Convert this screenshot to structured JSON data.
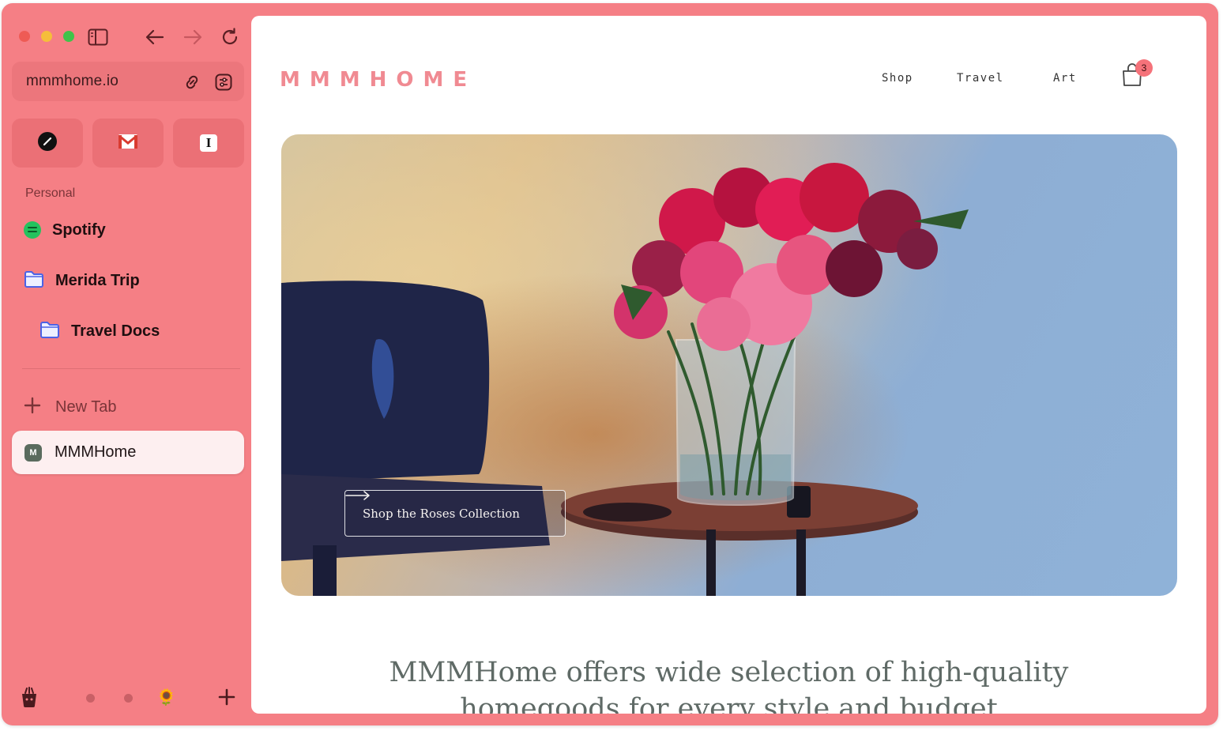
{
  "browser": {
    "url": "mmmhome.io",
    "favorites": [
      {
        "name": "notion",
        "icon": "notion-icon"
      },
      {
        "name": "gmail",
        "icon": "gmail-icon"
      },
      {
        "name": "instapaper",
        "icon": "instapaper-icon",
        "glyph": "I"
      }
    ],
    "section_label": "Personal",
    "items": [
      {
        "label": "Spotify",
        "icon": "spotify-icon"
      },
      {
        "label": "Merida Trip",
        "icon": "folder-icon"
      },
      {
        "label": "Travel Docs",
        "icon": "folder-icon"
      }
    ],
    "new_tab_label": "New Tab",
    "active_tab": {
      "label": "MMMHome",
      "favicon_letter": "M"
    },
    "space_emoji": "🌻",
    "accent_color": "#f57f85"
  },
  "site": {
    "logo": "MMMHOME",
    "nav": [
      "Shop",
      "Travel",
      "Art"
    ],
    "cart_count": "3",
    "hero_cta": "Shop the Roses Collection",
    "tagline_line1": "MMMHome offers wide selection of high-quality",
    "tagline_line2": "homegoods for every style and budget"
  }
}
